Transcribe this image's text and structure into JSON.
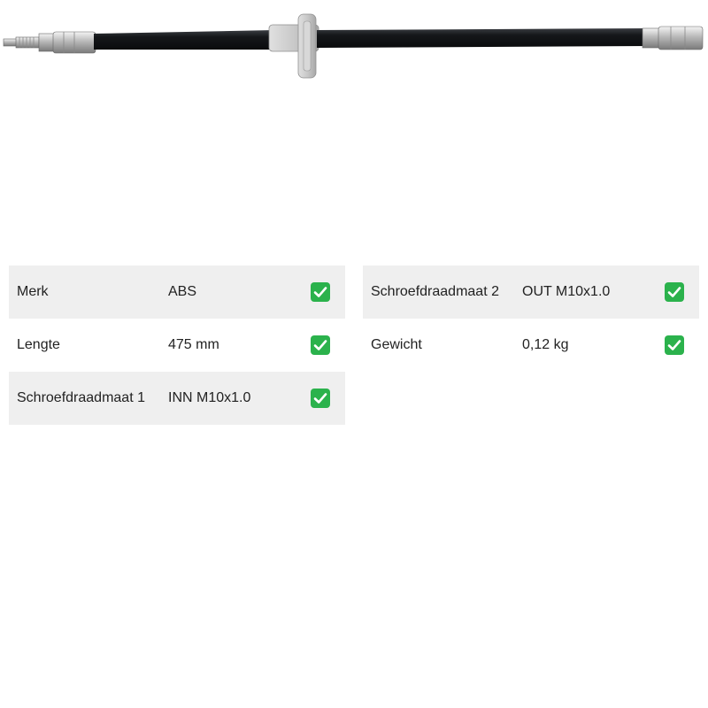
{
  "product": {
    "image_icon": "brake-hose-image"
  },
  "specs_left": [
    {
      "label": "Merk",
      "value": "ABS",
      "status_icon": "check-icon"
    },
    {
      "label": "Lengte",
      "value": "475 mm",
      "status_icon": "check-icon"
    },
    {
      "label": "Schroefdraadmaat 1",
      "value": "INN M10x1.0",
      "status_icon": "check-icon"
    }
  ],
  "specs_right": [
    {
      "label": "Schroefdraadmaat 2",
      "value": "OUT M10x1.0",
      "status_icon": "check-icon"
    },
    {
      "label": "Gewicht",
      "value": "0,12 kg",
      "status_icon": "check-icon"
    }
  ],
  "colors": {
    "check_green": "#2bb24c",
    "row_shade": "#efefef"
  }
}
